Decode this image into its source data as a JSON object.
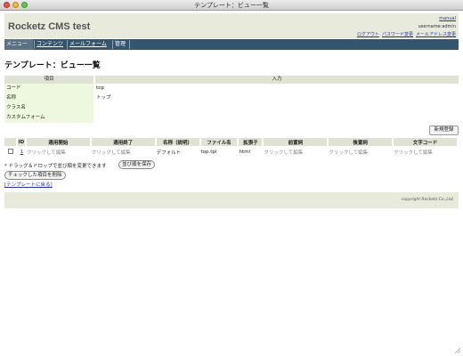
{
  "window": {
    "title": "テンプレート：ビュー一覧"
  },
  "header": {
    "logo": "Rocketz CMS test",
    "manual": "manual",
    "username": "username:admin",
    "links": [
      "ログアウト",
      "パスワード変更",
      "メールアドレス変更"
    ]
  },
  "nav": {
    "items": [
      "メニュー",
      "コンテンツ",
      "メールフォーム",
      "管理"
    ]
  },
  "page": {
    "title": "テンプレート：ビュー一覧"
  },
  "form": {
    "header_item": "項目",
    "header_input": "入力",
    "rows": [
      {
        "label": "コード",
        "value": "top"
      },
      {
        "label": "名称",
        "value": "トップ"
      },
      {
        "label": "クラス名",
        "value": ""
      },
      {
        "label": "カスタムフォーム",
        "value": ""
      }
    ]
  },
  "new_button": "新規登録",
  "list": {
    "columns": [
      "",
      "ID",
      "適用開始",
      "適用終了",
      "名称（説明）",
      "ファイル名",
      "拡張子",
      "前置詞",
      "後置詞",
      "文字コード"
    ],
    "rows": [
      {
        "id": "1",
        "start": "クリックして編集",
        "end": "クリックして編集",
        "name": "デフォルト",
        "file": "top.tpl",
        "ext": "html",
        "prefix": "クリックして編集",
        "suffix": "クリックして編集",
        "charset": "クリックして編集"
      }
    ]
  },
  "note": "* ドラッグ＆ドロップで並び順を変更できます",
  "save_order_button": "並び順を保存",
  "delete_checked_button": "チェックした項目を削除",
  "back_link": "[テンプレートに戻る]",
  "footer": {
    "copyright": "copyright Rocketz Co.,Ltd."
  }
}
